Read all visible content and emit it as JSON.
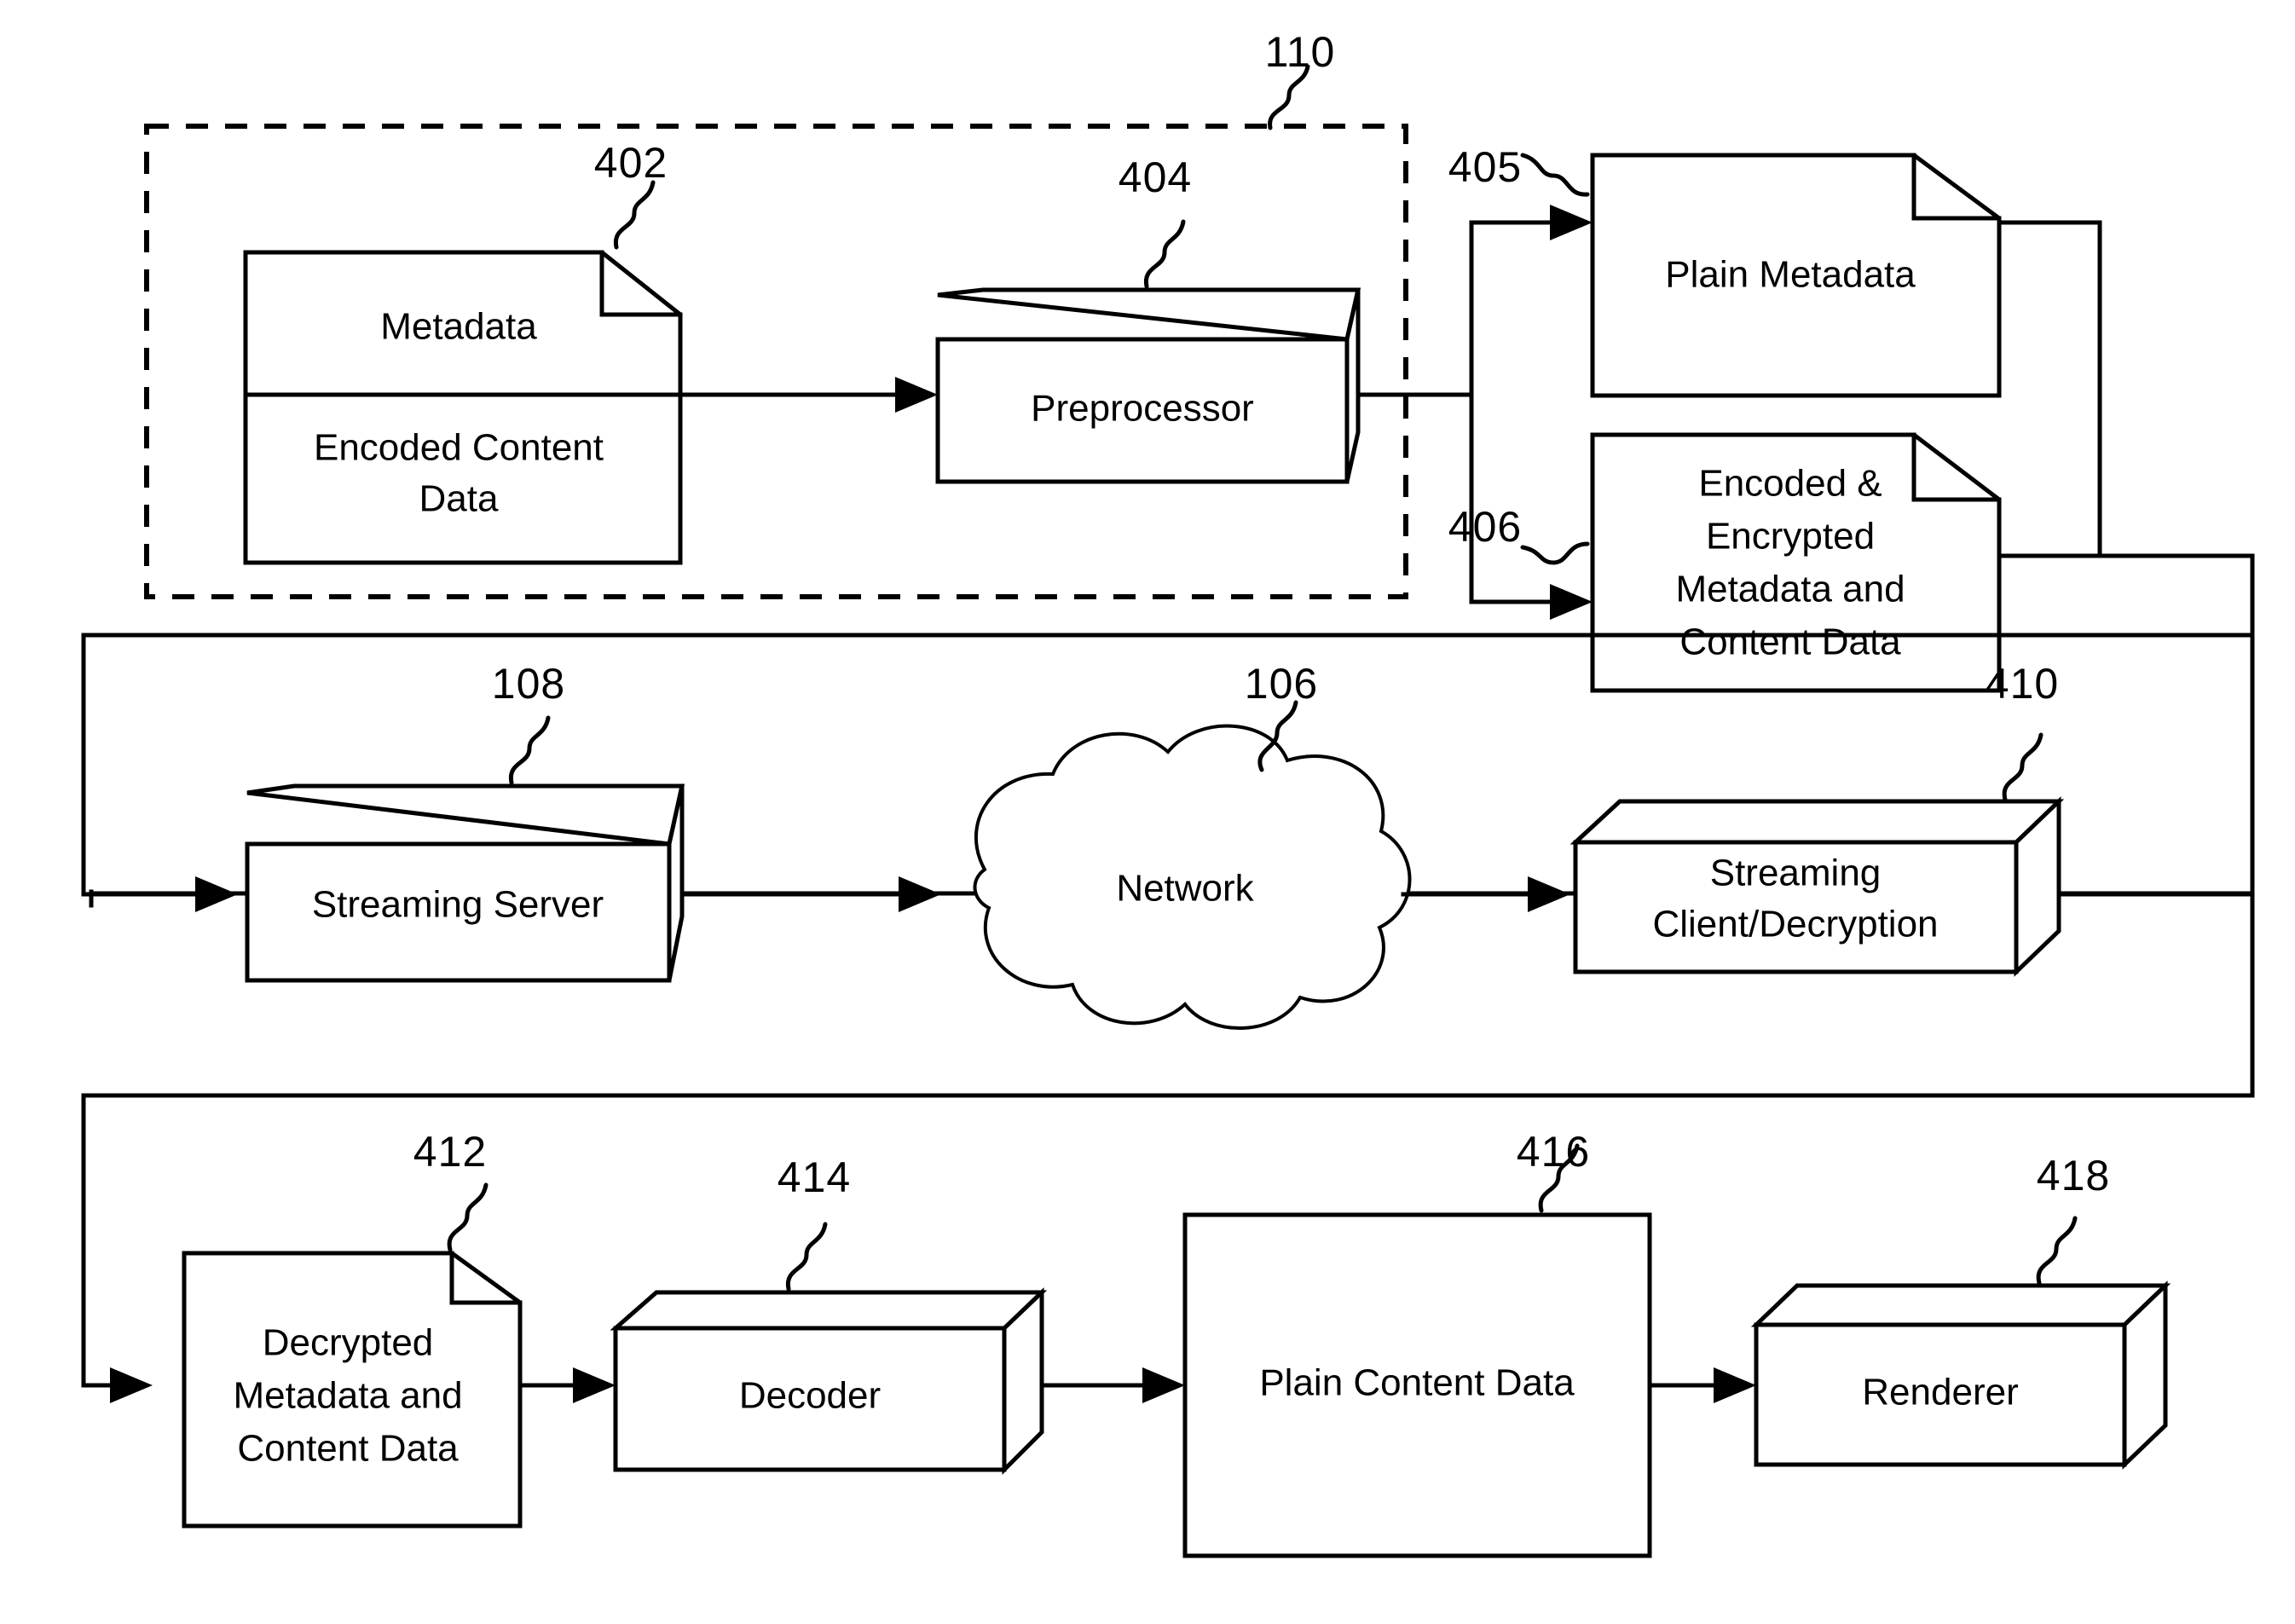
{
  "figure": {
    "type": "patent-block-diagram",
    "background_color": "#ffffff",
    "line_color": "#000000"
  },
  "group": {
    "ref": "110",
    "style": "dashed-border",
    "name": "preprocessing-group"
  },
  "row1": {
    "source_document": {
      "ref": "402",
      "shape": "document-folded-corner",
      "sections": [
        {
          "label": "Metadata"
        },
        {
          "label": "Encoded Content Data"
        }
      ]
    },
    "preprocessor": {
      "ref": "404",
      "shape": "cube-3d",
      "label": "Preprocessor"
    },
    "plain_metadata": {
      "ref": "405",
      "shape": "document-folded-corner",
      "label": "Plain Metadata"
    },
    "encrypted_document": {
      "ref": "406",
      "shape": "document-folded-corner",
      "label": "Encoded & Encrypted Metadata and Content Data",
      "lines": [
        "Encoded &",
        "Encrypted",
        "Metadata and",
        "Content Data"
      ]
    }
  },
  "row2": {
    "streaming_server": {
      "ref": "108",
      "shape": "cube-3d",
      "label": "Streaming Server"
    },
    "network": {
      "ref": "106",
      "shape": "cloud",
      "label": "Network"
    },
    "streaming_client": {
      "ref": "410",
      "shape": "cube-3d",
      "label": "Streaming Client/Decryption",
      "lines": [
        "Streaming",
        "Client/Decryption"
      ]
    }
  },
  "row3": {
    "decrypted_document": {
      "ref": "412",
      "shape": "document-folded-corner",
      "label": "Decrypted Metadata and Content Data",
      "lines": [
        "Decrypted",
        "Metadata and",
        "Content Data"
      ]
    },
    "decoder": {
      "ref": "414",
      "shape": "cube-3d",
      "label": "Decoder"
    },
    "plain_content_data": {
      "ref": "416",
      "shape": "rectangle",
      "label": "Plain Content Data"
    },
    "renderer": {
      "ref": "418",
      "shape": "cube-3d",
      "label": "Renderer"
    }
  },
  "connectors": [
    {
      "name": "source-to-preprocessor",
      "from": "402",
      "to": "404",
      "arrow": true
    },
    {
      "name": "preprocessor-to-plain-metadata",
      "from": "404",
      "to": "405",
      "arrow": true
    },
    {
      "name": "preprocessor-to-encrypted",
      "from": "404",
      "to": "406",
      "arrow": true
    },
    {
      "name": "row1-to-streaming-server",
      "from": "405/406",
      "to": "108",
      "arrow": true
    },
    {
      "name": "streaming-server-to-network",
      "from": "108",
      "to": "106",
      "arrow": true
    },
    {
      "name": "network-to-streaming-client",
      "from": "106",
      "to": "410",
      "arrow": true
    },
    {
      "name": "streaming-client-to-decrypted",
      "from": "410",
      "to": "412",
      "arrow": true
    },
    {
      "name": "decrypted-to-decoder",
      "from": "412",
      "to": "414",
      "arrow": true
    },
    {
      "name": "decoder-to-plain-content",
      "from": "414",
      "to": "416",
      "arrow": true
    },
    {
      "name": "plain-content-to-renderer",
      "from": "416",
      "to": "418",
      "arrow": true
    }
  ]
}
